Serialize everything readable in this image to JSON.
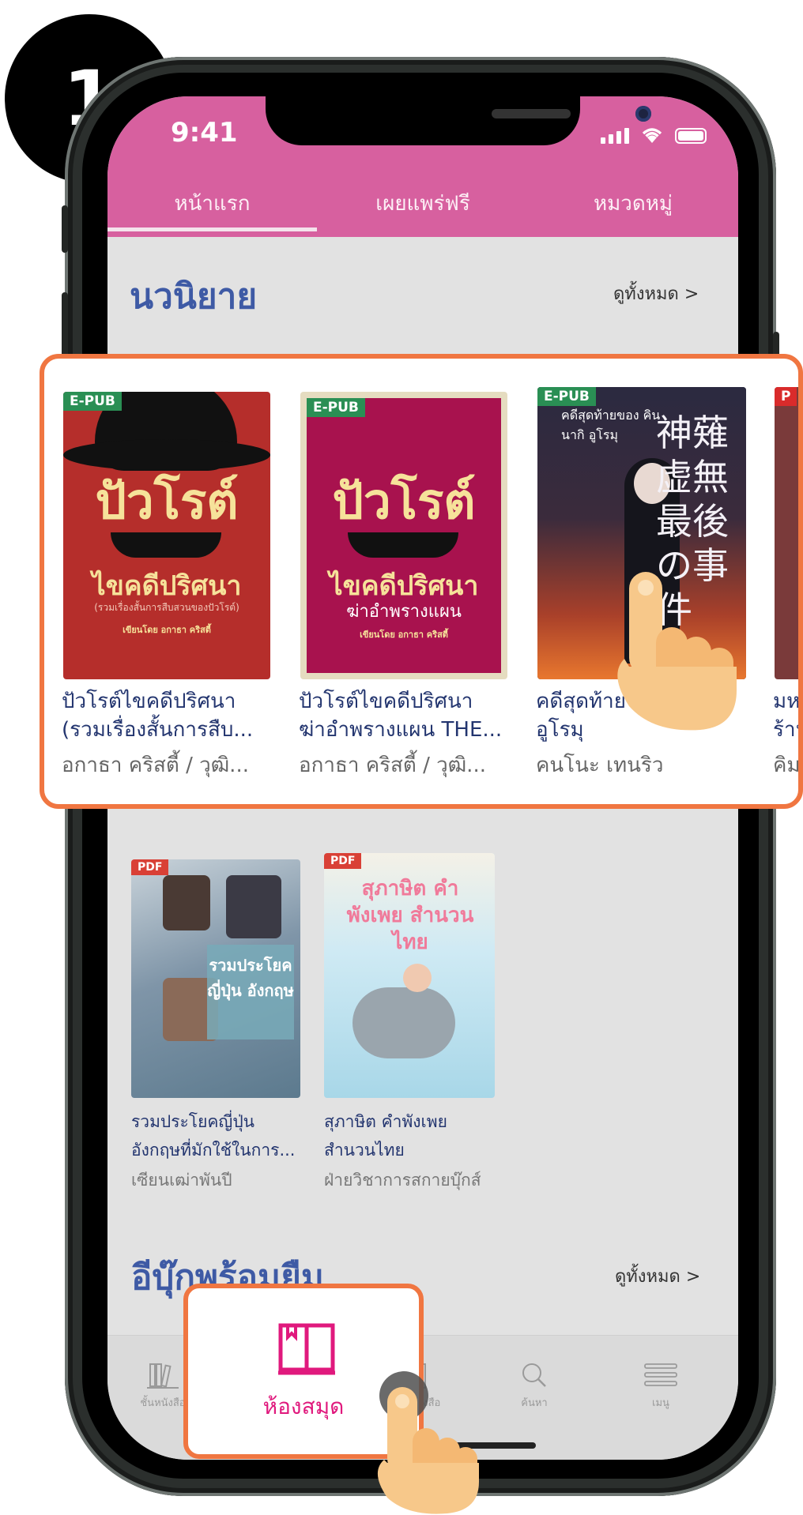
{
  "step": {
    "number": "1"
  },
  "status_bar": {
    "time": "9:41"
  },
  "tabs": [
    {
      "label": "หน้าแรก"
    },
    {
      "label": "เผยแพร่ฟรี"
    },
    {
      "label": "หมวดหมู่"
    }
  ],
  "sections": {
    "novels": {
      "title": "นวนิยาย",
      "see_all": "ดูทั้งหมด >"
    },
    "rental": {
      "title": "อีบุ๊กพร้อมยืม",
      "see_all": "ดูทั้งหมด >"
    }
  },
  "featured_books": [
    {
      "badge": "E-PUB",
      "cover_title": "ปัวโรต์",
      "cover_subtitle": "ไขคดีปริศนา",
      "cover_note": "(รวมเรื่องสั้นการสืบสวนของปัวโรต์)",
      "cover_author": "เขียนโดย อกาธา คริสตี้",
      "title_line1": "ปัวโรต์ไขคดีปริศนา",
      "title_line2": "(รวมเรื่องสั้นการสืบ...",
      "author": "อกาธา คริสตี้ / วุฒิ..."
    },
    {
      "badge": "E-PUB",
      "cover_title": "ปัวโรต์",
      "cover_subtitle": "ไขคดีปริศนา",
      "cover_note": "ฆ่าอำพรางแผน",
      "cover_author": "เขียนโดย อกาธา คริสตี้",
      "title_line1": "ปัวโรต์ไขคดีปริศนา",
      "title_line2": "ฆ่าอำพรางแผน THE...",
      "author": "อกาธา คริสตี้ / วุฒิ..."
    },
    {
      "badge": "E-PUB",
      "cover_title": "คดีสุดท้ายของ คินนากิ อูโรมุ",
      "title_line1": "คดีสุดท้ายของ คินนากิ",
      "title_line2": "อูโรมุ",
      "author": "คนโนะ เทนริว"
    },
    {
      "badge": "P",
      "title_line1": "มห",
      "title_line2": "ร้าน",
      "author": "คิม"
    }
  ],
  "more_books": [
    {
      "badge": "PDF",
      "cover_text": "รวมประโยค ญี่ปุ่น อังกฤษ",
      "title_line1": "รวมประโยคญี่ปุ่น",
      "title_line2": "อังกฤษที่มักใช้ในการ...",
      "author": "เซียนเฒ่าพันปี"
    },
    {
      "badge": "PDF",
      "cover_text": "สุภาษิต คำพังเพย สำนวนไทย",
      "title_line1": "สุภาษิต คำพังเพย",
      "title_line2": "สำนวนไทย",
      "author": "ฝ่ายวิชาการสกายบุ๊กส์"
    }
  ],
  "tabbar": [
    {
      "label": "ชั้นหนังสือ",
      "icon": "bookshelf-icon"
    },
    {
      "label": "ห้องสมุด",
      "icon": "library-icon"
    },
    {
      "label": "ร้านหนังสือ",
      "icon": "book-icon"
    },
    {
      "label": "ค้นหา",
      "icon": "search-icon"
    },
    {
      "label": "เมนู",
      "icon": "menu-icon"
    }
  ],
  "library_popup": {
    "label": "ห้องสมุด"
  },
  "colors": {
    "header": "#d7609f",
    "highlight": "#f07641",
    "library_accent": "#e0197d",
    "section_title": "#3e5aa5"
  }
}
